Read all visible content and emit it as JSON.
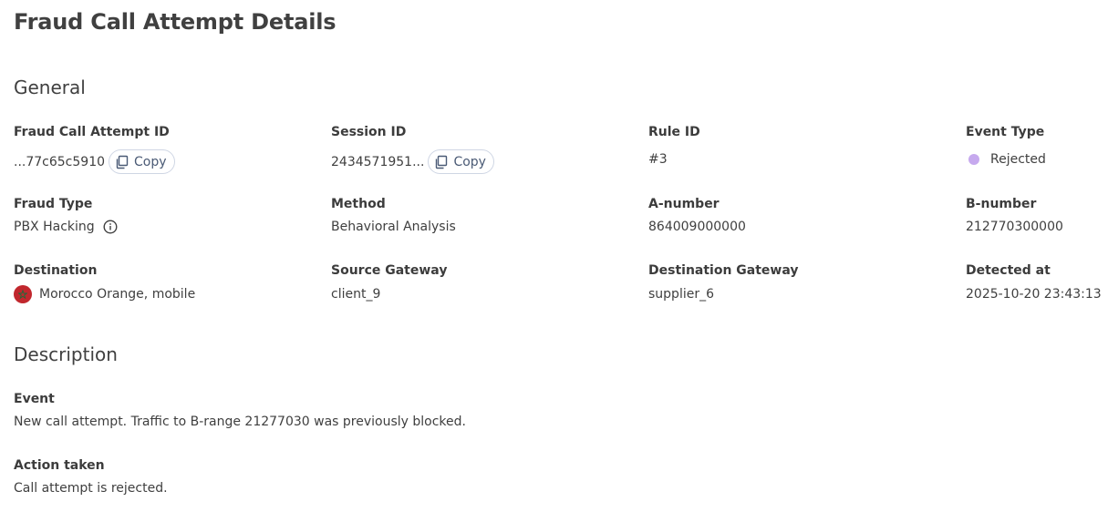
{
  "page": {
    "title": "Fraud Call Attempt Details"
  },
  "general": {
    "title": "General",
    "fraud_call_attempt_id": {
      "label": "Fraud Call Attempt ID",
      "value": "...77c65c5910",
      "copy_label": "Copy"
    },
    "session_id": {
      "label": "Session ID",
      "value": "2434571951...",
      "copy_label": "Copy"
    },
    "rule_id": {
      "label": "Rule ID",
      "value": "#3"
    },
    "event_type": {
      "label": "Event Type",
      "value": "Rejected",
      "dot_color": "#c6a9ee"
    },
    "fraud_type": {
      "label": "Fraud Type",
      "value": "PBX Hacking",
      "icon": "info-icon"
    },
    "method": {
      "label": "Method",
      "value": "Behavioral Analysis"
    },
    "a_number": {
      "label": "A-number",
      "value": "864009000000"
    },
    "b_number": {
      "label": "B-number",
      "value": "212770300000"
    },
    "destination": {
      "label": "Destination",
      "value": "Morocco Orange, mobile",
      "flag_color": "#c1272d",
      "icon": "morocco-flag-icon"
    },
    "source_gateway": {
      "label": "Source Gateway",
      "value": "client_9"
    },
    "destination_gateway": {
      "label": "Destination Gateway",
      "value": "supplier_6"
    },
    "detected_at": {
      "label": "Detected at",
      "value": "2025-10-20 23:43:13"
    }
  },
  "description": {
    "title": "Description",
    "event": {
      "label": "Event",
      "value": "New call attempt. Traffic to B-range 21277030 was previously blocked."
    },
    "action_taken": {
      "label": "Action taken",
      "value": "Call attempt is rejected."
    }
  }
}
